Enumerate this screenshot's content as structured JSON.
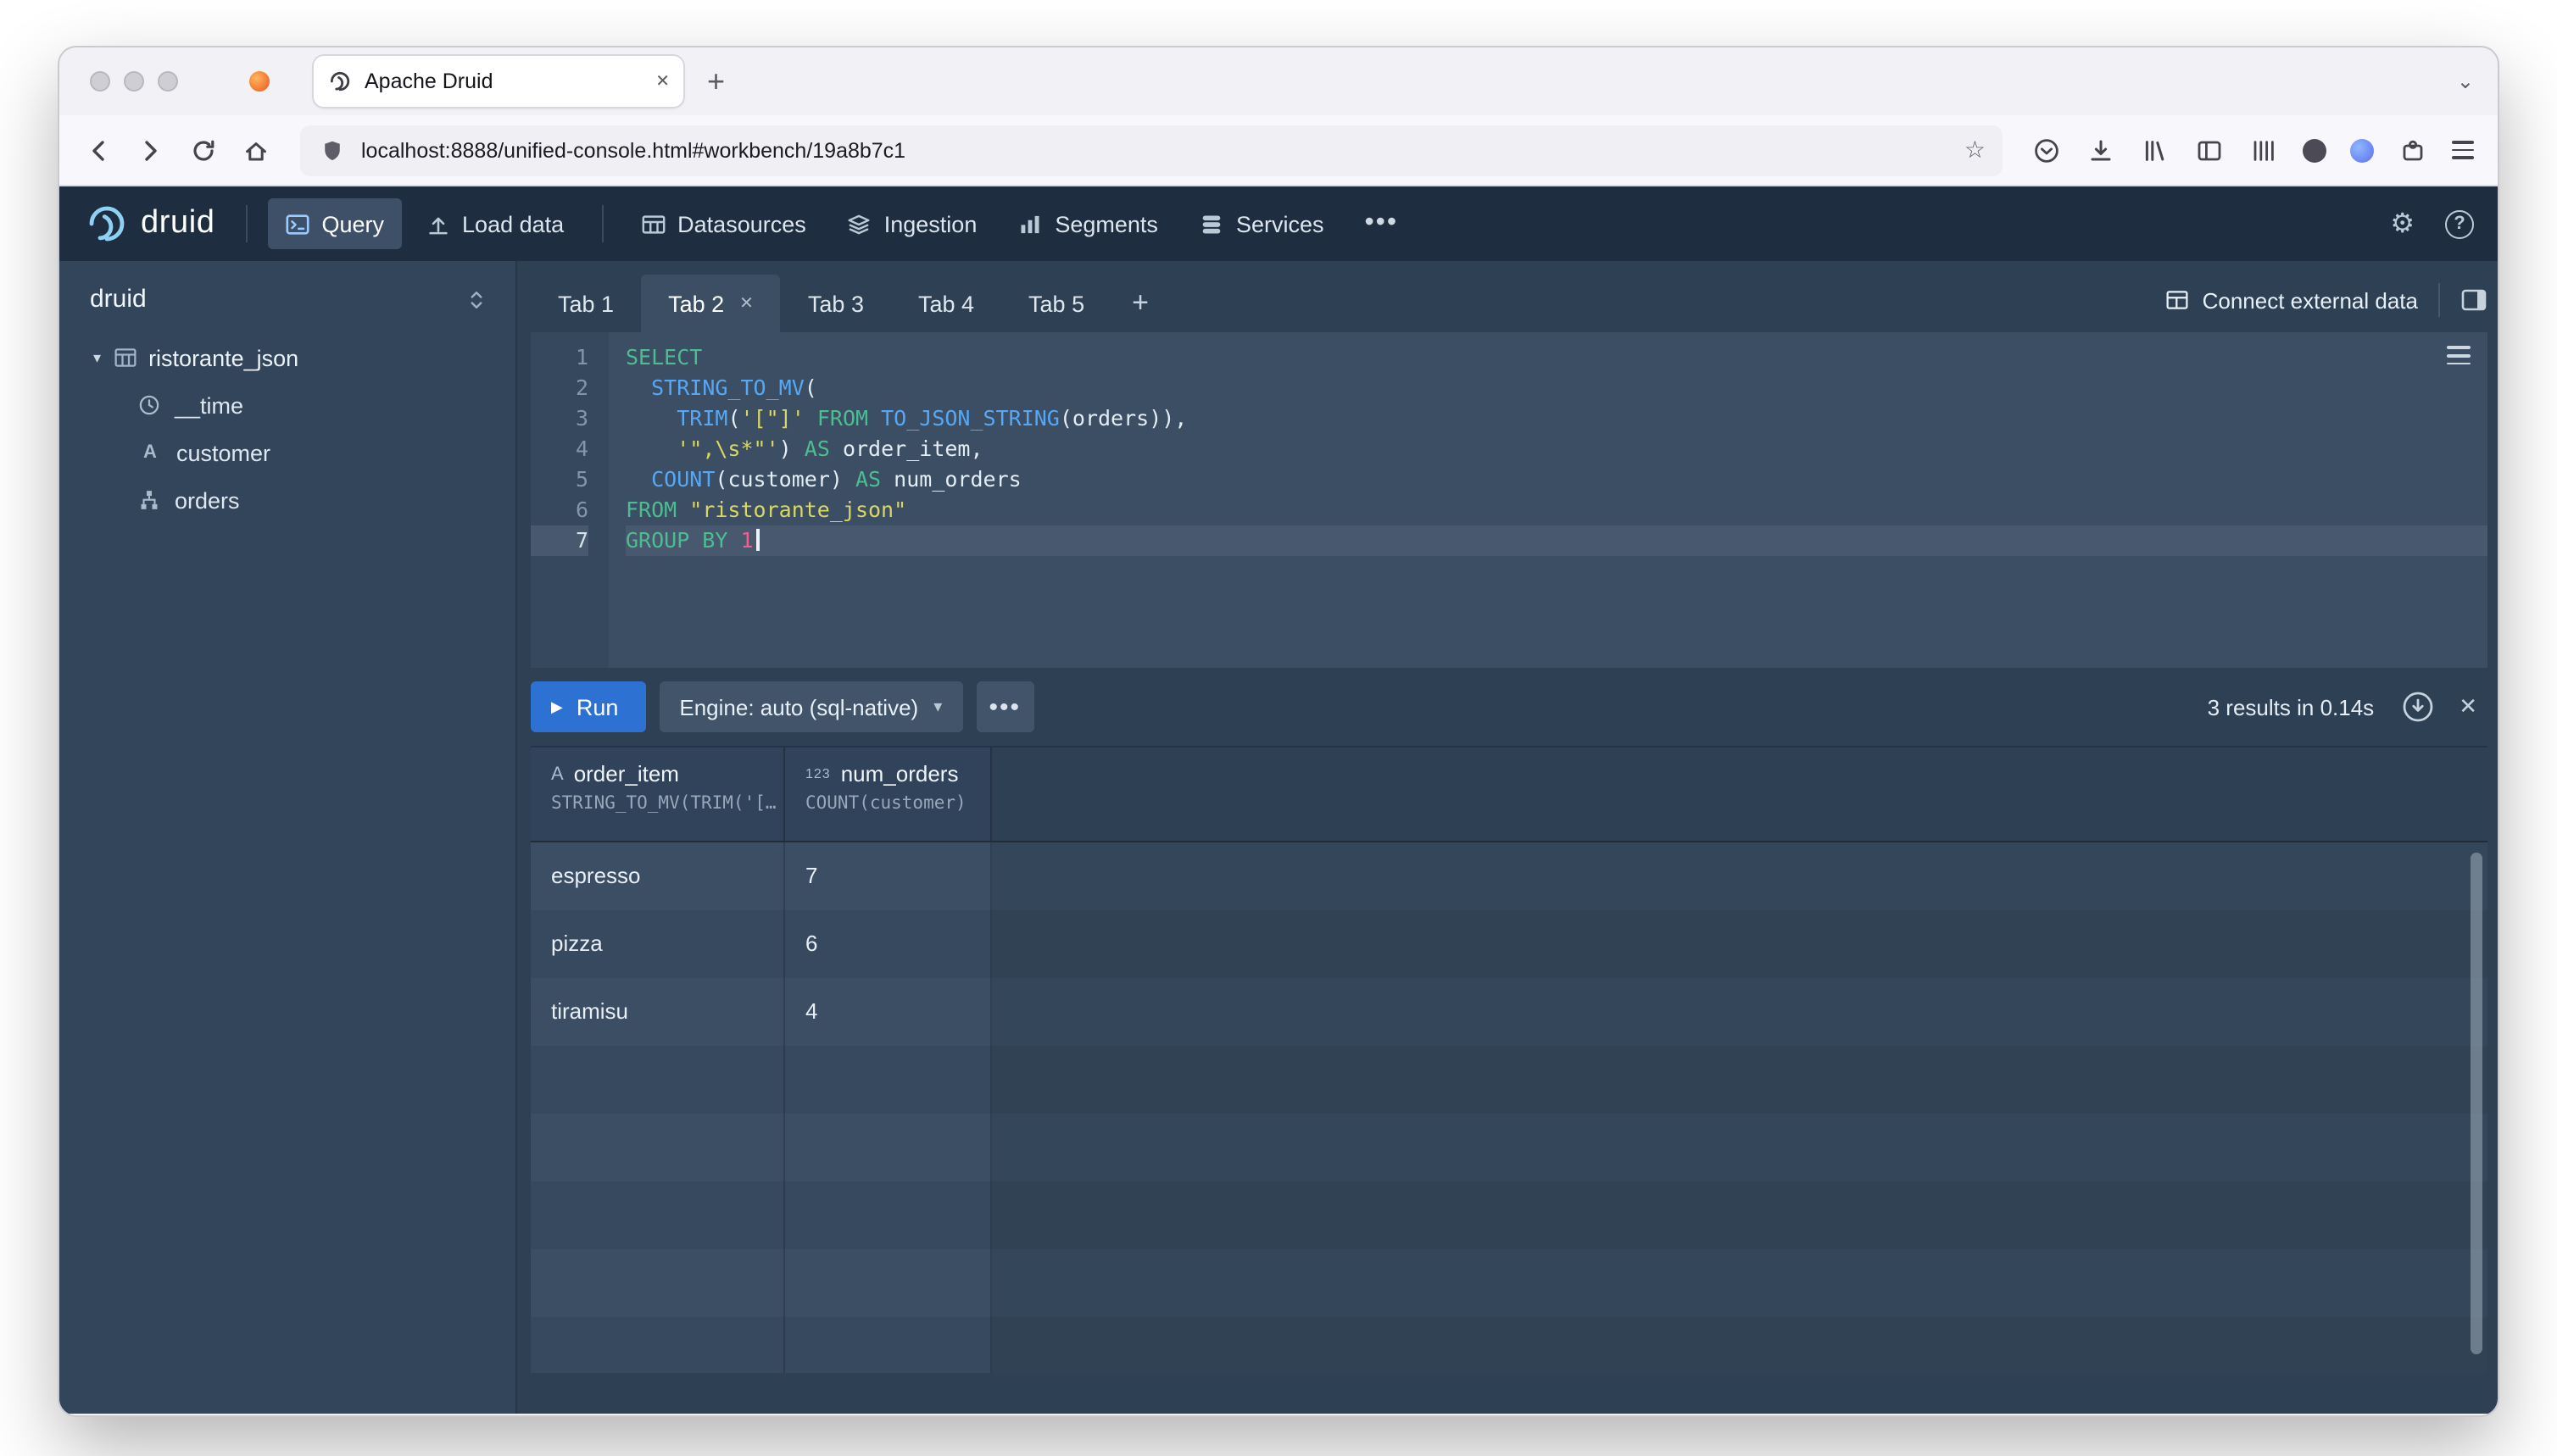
{
  "browser": {
    "tab_title": "Apache Druid",
    "url": "localhost:8888/unified-console.html#workbench/19a8b7c1",
    "new_tab_label": "+"
  },
  "navbar": {
    "brand": "druid",
    "items": [
      {
        "label": "Query"
      },
      {
        "label": "Load data"
      },
      {
        "label": "Datasources"
      },
      {
        "label": "Ingestion"
      },
      {
        "label": "Segments"
      },
      {
        "label": "Services"
      }
    ]
  },
  "sidebar": {
    "title": "druid",
    "root": {
      "label": "ristorante_json"
    },
    "children": [
      {
        "label": "__time",
        "type": "time"
      },
      {
        "label": "customer",
        "type": "string"
      },
      {
        "label": "orders",
        "type": "complex"
      }
    ]
  },
  "workbench": {
    "tabs": [
      "Tab 1",
      "Tab 2",
      "Tab 3",
      "Tab 4",
      "Tab 5"
    ],
    "active_tab": "Tab 2",
    "connect_label": "Connect external data"
  },
  "editor": {
    "active_line": 7,
    "lines": [
      [
        {
          "c": "kw",
          "t": "SELECT"
        }
      ],
      [
        {
          "c": "pl",
          "t": "  "
        },
        {
          "c": "fn",
          "t": "STRING_TO_MV"
        },
        {
          "c": "pl",
          "t": "("
        }
      ],
      [
        {
          "c": "pl",
          "t": "    "
        },
        {
          "c": "fn",
          "t": "TRIM"
        },
        {
          "c": "pl",
          "t": "("
        },
        {
          "c": "str",
          "t": "'[\"]'"
        },
        {
          "c": "pl",
          "t": " "
        },
        {
          "c": "kw",
          "t": "FROM"
        },
        {
          "c": "pl",
          "t": " "
        },
        {
          "c": "fn",
          "t": "TO_JSON_STRING"
        },
        {
          "c": "pl",
          "t": "(orders)),"
        }
      ],
      [
        {
          "c": "pl",
          "t": "    "
        },
        {
          "c": "str",
          "t": "'\",\\s*\"'"
        },
        {
          "c": "pl",
          "t": ") "
        },
        {
          "c": "kw",
          "t": "AS"
        },
        {
          "c": "pl",
          "t": " order_item,"
        }
      ],
      [
        {
          "c": "pl",
          "t": "  "
        },
        {
          "c": "fn",
          "t": "COUNT"
        },
        {
          "c": "pl",
          "t": "(customer) "
        },
        {
          "c": "kw",
          "t": "AS"
        },
        {
          "c": "pl",
          "t": " num_orders"
        }
      ],
      [
        {
          "c": "kw",
          "t": "FROM"
        },
        {
          "c": "pl",
          "t": " "
        },
        {
          "c": "str",
          "t": "\"ristorante_json\""
        }
      ],
      [
        {
          "c": "kw",
          "t": "GROUP BY"
        },
        {
          "c": "pl",
          "t": " "
        },
        {
          "c": "num",
          "t": "1"
        }
      ]
    ]
  },
  "runbar": {
    "run_label": "Run",
    "engine_label": "Engine: auto (sql-native)",
    "results_info": "3 results in 0.14s"
  },
  "results": {
    "columns": [
      {
        "type_icon": "A",
        "name": "order_item",
        "expr": "STRING_TO_MV(TRIM('[…"
      },
      {
        "type_icon": "123",
        "name": "num_orders",
        "expr": "COUNT(customer)"
      }
    ],
    "rows": [
      [
        "espresso",
        "7"
      ],
      [
        "pizza",
        "6"
      ],
      [
        "tiramisu",
        "4"
      ]
    ]
  },
  "colors": {
    "accent": "#2d72d2",
    "navbar_bg": "#1f2d40",
    "console_bg": "#2e4054",
    "editor_bg": "#3b4e64",
    "keyword": "#4dbd91",
    "function": "#56a8f5",
    "string": "#d9d762",
    "number": "#f0608c"
  }
}
